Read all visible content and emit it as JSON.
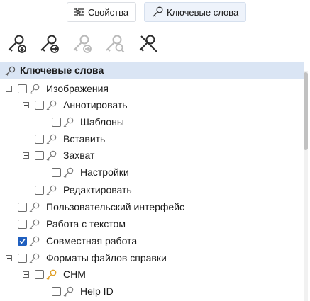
{
  "tabs": {
    "properties_label": "Свойства",
    "keywords_label": "Ключевые слова"
  },
  "toolbar": {
    "icons": [
      "keyword-add-child-icon",
      "keyword-add-sibling-icon",
      "keyword-disabled-icon",
      "keyword-search-disabled-icon",
      "keyword-remove-icon"
    ]
  },
  "tree": {
    "header": "Ключевые слова",
    "items": [
      {
        "label": "Изображения",
        "checked": false,
        "expanded": true
      },
      {
        "label": "Аннотировать",
        "checked": false,
        "expanded": true
      },
      {
        "label": "Шаблоны",
        "checked": false
      },
      {
        "label": "Вставить",
        "checked": false
      },
      {
        "label": "Захват",
        "checked": false,
        "expanded": true
      },
      {
        "label": "Настройки",
        "checked": false
      },
      {
        "label": "Редактировать",
        "checked": false
      },
      {
        "label": "Пользовательский интерфейс",
        "checked": false
      },
      {
        "label": "Работа с текстом",
        "checked": false
      },
      {
        "label": "Совместная работа",
        "checked": true
      },
      {
        "label": "Форматы файлов справки",
        "checked": false,
        "expanded": true
      },
      {
        "label": "CHM",
        "checked": false,
        "expanded": true,
        "icon_color": "#e0a028"
      },
      {
        "label": "Help ID",
        "checked": false
      }
    ]
  },
  "colors": {
    "header_bg": "#dae5f4",
    "checked_bg": "#1f5fbf",
    "highlight_key": "#e0a028"
  }
}
